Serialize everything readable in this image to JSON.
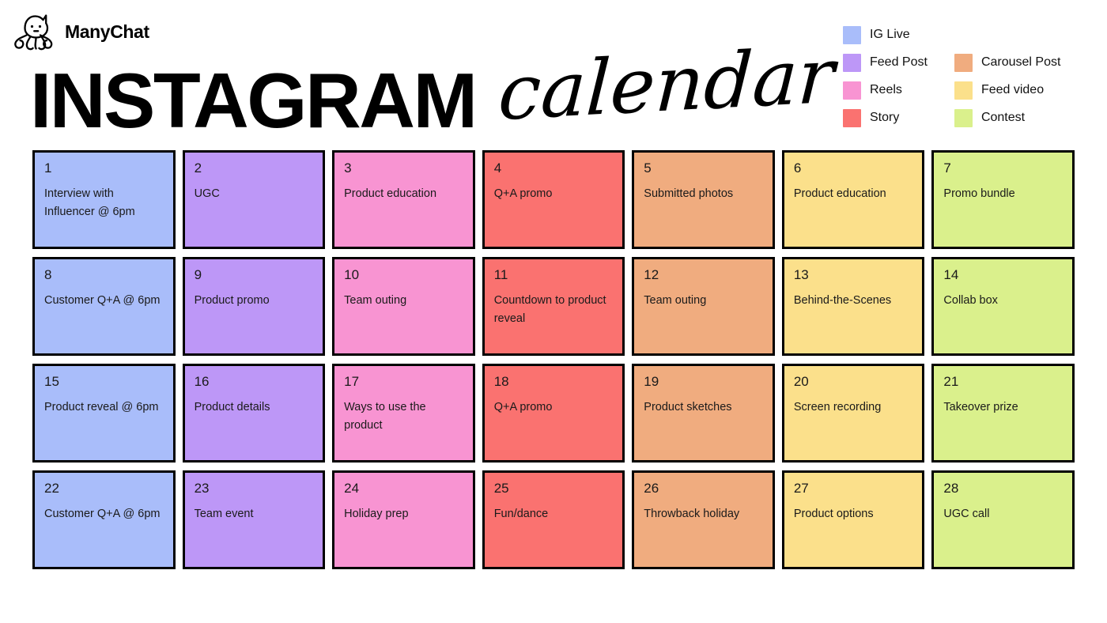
{
  "brand": {
    "name": "ManyChat",
    "logo_icon": "manychat-octopus-logo"
  },
  "title": {
    "bold": "INSTAGRAM",
    "script": "calendar"
  },
  "colors": {
    "ig_live": "#A9BDFA",
    "feed_post": "#BD97F7",
    "reels": "#F894D2",
    "story": "#FA7270",
    "carousel_post": "#F0AC7F",
    "feed_video": "#FBE08B",
    "contest": "#DAF08C",
    "border": "#000000",
    "background": "#FFFFFF",
    "text": "#1A1A1A"
  },
  "legend": {
    "items": [
      {
        "label": "IG Live",
        "color": "#A9BDFA",
        "column": "left"
      },
      {
        "label": "Feed Post",
        "color": "#BD97F7",
        "column": "left"
      },
      {
        "label": "Reels",
        "color": "#F894D2",
        "column": "left"
      },
      {
        "label": "Story",
        "color": "#FA7270",
        "column": "left"
      },
      {
        "label": "Carousel Post",
        "color": "#F0AC7F",
        "column": "right"
      },
      {
        "label": "Feed video",
        "color": "#FBE08B",
        "column": "right"
      },
      {
        "label": "Contest",
        "color": "#DAF08C",
        "column": "right"
      }
    ]
  },
  "calendar": {
    "columns": 7,
    "rows": 4,
    "cells": [
      {
        "number": "1",
        "text": "Interview with Influencer @ 6pm",
        "category": "IG Live",
        "color": "#A9BDFA"
      },
      {
        "number": "2",
        "text": "UGC",
        "category": "Feed Post",
        "color": "#BD97F7"
      },
      {
        "number": "3",
        "text": "Product education",
        "category": "Reels",
        "color": "#F894D2"
      },
      {
        "number": "4",
        "text": "Q+A promo",
        "category": "Story",
        "color": "#FA7270"
      },
      {
        "number": "5",
        "text": "Submitted photos",
        "category": "Carousel Post",
        "color": "#F0AC7F"
      },
      {
        "number": "6",
        "text": "Product education",
        "category": "Feed video",
        "color": "#FBE08B"
      },
      {
        "number": "7",
        "text": "Promo bundle",
        "category": "Contest",
        "color": "#DAF08C"
      },
      {
        "number": "8",
        "text": "Customer Q+A @ 6pm",
        "category": "IG Live",
        "color": "#A9BDFA"
      },
      {
        "number": "9",
        "text": "Product promo",
        "category": "Feed Post",
        "color": "#BD97F7"
      },
      {
        "number": "10",
        "text": "Team outing",
        "category": "Reels",
        "color": "#F894D2"
      },
      {
        "number": "11",
        "text": "Countdown to product reveal",
        "category": "Story",
        "color": "#FA7270"
      },
      {
        "number": "12",
        "text": "Team outing",
        "category": "Carousel Post",
        "color": "#F0AC7F"
      },
      {
        "number": "13",
        "text": "Behind-the-Scenes",
        "category": "Feed video",
        "color": "#FBE08B"
      },
      {
        "number": "14",
        "text": "Collab box",
        "category": "Contest",
        "color": "#DAF08C"
      },
      {
        "number": "15",
        "text": "Product reveal @ 6pm",
        "category": "IG Live",
        "color": "#A9BDFA"
      },
      {
        "number": "16",
        "text": "Product details",
        "category": "Feed Post",
        "color": "#BD97F7"
      },
      {
        "number": "17",
        "text": "Ways to use the product",
        "category": "Reels",
        "color": "#F894D2"
      },
      {
        "number": "18",
        "text": "Q+A promo",
        "category": "Story",
        "color": "#FA7270"
      },
      {
        "number": "19",
        "text": "Product sketches",
        "category": "Carousel Post",
        "color": "#F0AC7F"
      },
      {
        "number": "20",
        "text": "Screen recording",
        "category": "Feed video",
        "color": "#FBE08B"
      },
      {
        "number": "21",
        "text": "Takeover prize",
        "category": "Contest",
        "color": "#DAF08C"
      },
      {
        "number": "22",
        "text": "Customer Q+A @ 6pm",
        "category": "IG Live",
        "color": "#A9BDFA"
      },
      {
        "number": "23",
        "text": "Team event",
        "category": "Feed Post",
        "color": "#BD97F7"
      },
      {
        "number": "24",
        "text": "Holiday prep",
        "category": "Reels",
        "color": "#F894D2"
      },
      {
        "number": "25",
        "text": "Fun/dance",
        "category": "Story",
        "color": "#FA7270"
      },
      {
        "number": "26",
        "text": "Throwback holiday",
        "category": "Carousel Post",
        "color": "#F0AC7F"
      },
      {
        "number": "27",
        "text": "Product options",
        "category": "Feed video",
        "color": "#FBE08B"
      },
      {
        "number": "28",
        "text": "UGC call",
        "category": "Contest",
        "color": "#DAF08C"
      }
    ]
  }
}
